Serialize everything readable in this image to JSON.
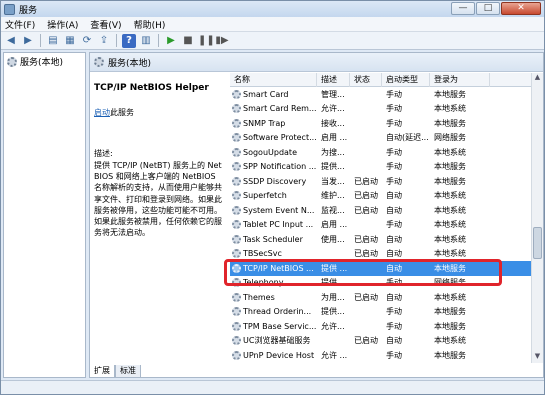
{
  "window": {
    "title": "服务",
    "controls": {
      "minimize": "—",
      "maximize": "□",
      "close": "✕"
    }
  },
  "menu": [
    "文件(F)",
    "操作(A)",
    "查看(V)",
    "帮助(H)"
  ],
  "toolbar": {
    "icons": [
      "back-icon",
      "forward-icon",
      "sep",
      "console-tree-icon",
      "properties-icon",
      "refresh-icon",
      "export-icon",
      "sep",
      "help-icon",
      "details-icon",
      "sep",
      "start-service-icon",
      "stop-service-icon",
      "pause-service-icon",
      "restart-service-icon"
    ]
  },
  "tree": {
    "root_label": "服务(本地)"
  },
  "pane": {
    "header": "服务(本地)",
    "selected_service": "TCP/IP NetBIOS Helper",
    "start_link": "启动",
    "start_suffix": "此服务",
    "desc_label": "描述:",
    "desc_text": "提供 TCP/IP (NetBT) 服务上的 NetBIOS 和网络上客户端的 NetBIOS 名称解析的支持，从而使用户能够共享文件、打印和登录到网络。如果此服务被停用，这些功能可能不可用。如果此服务被禁用，任何依赖它的服务将无法启动。"
  },
  "table": {
    "headers": [
      "名称",
      "描述",
      "状态",
      "启动类型",
      "登录为"
    ],
    "rows": [
      [
        "Smart Card",
        "管理...",
        "",
        "手动",
        "本地服务"
      ],
      [
        "Smart Card Rem...",
        "允许...",
        "",
        "手动",
        "本地系统"
      ],
      [
        "SNMP Trap",
        "接收...",
        "",
        "手动",
        "本地服务"
      ],
      [
        "Software Protect...",
        "启用 ...",
        "",
        "自动(延迟...",
        "网络服务"
      ],
      [
        "SogouUpdate",
        "为搜...",
        "",
        "手动",
        "本地系统"
      ],
      [
        "SPP Notification ...",
        "提供...",
        "",
        "手动",
        "本地服务"
      ],
      [
        "SSDP Discovery",
        "当发...",
        "已启动",
        "手动",
        "本地服务"
      ],
      [
        "Superfetch",
        "维护...",
        "已启动",
        "自动",
        "本地系统"
      ],
      [
        "System Event N...",
        "监视...",
        "已启动",
        "自动",
        "本地系统"
      ],
      [
        "Tablet PC Input ...",
        "启用 ...",
        "",
        "手动",
        "本地系统"
      ],
      [
        "Task Scheduler",
        "使用...",
        "已启动",
        "自动",
        "本地系统"
      ],
      [
        "TBSecSvc",
        "",
        "已启动",
        "自动",
        "本地系统"
      ],
      [
        "TCP/IP NetBIOS ...",
        "提供 ...",
        "",
        "自动",
        "本地服务"
      ],
      [
        "Telephony",
        "提供...",
        "",
        "手动",
        "网络服务"
      ],
      [
        "Themes",
        "为用...",
        "已启动",
        "自动",
        "本地系统"
      ],
      [
        "Thread Orderin...",
        "提供...",
        "",
        "手动",
        "本地服务"
      ],
      [
        "TPM Base Servic...",
        "允许...",
        "",
        "手动",
        "本地服务"
      ],
      [
        "UC浏览器基础服务",
        "",
        "已启动",
        "自动",
        "本地系统"
      ],
      [
        "UPnP Device Host",
        "允许 ...",
        "",
        "手动",
        "本地服务"
      ]
    ],
    "selected_index": 12
  },
  "tabs": [
    "扩展",
    "标准"
  ],
  "colors": {
    "selection": "#3a8ee6",
    "highlight_box": "#e0242b",
    "link": "#1a5fb4"
  }
}
